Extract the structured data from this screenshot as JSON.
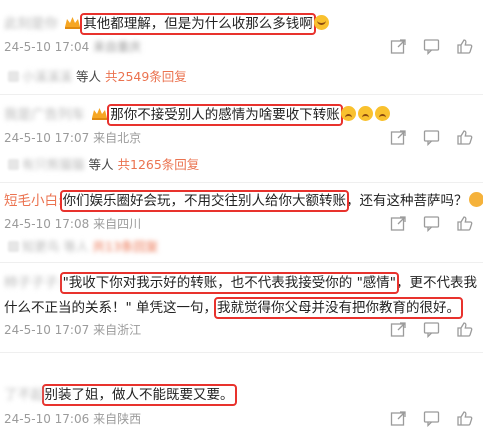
{
  "comments": [
    {
      "username": "此刻是你",
      "text": "其他都理解，但是为什么收那么多钱啊",
      "meta_date": "24-5-10 17:04",
      "meta_from": "来自重庆",
      "reply_user": "小溪溪溪",
      "reply_suffix": "等人",
      "reply_count": "共2549条回复"
    },
    {
      "username": "我是广告列车",
      "text": "那你不接受别人的感情为啥要收下转账",
      "meta_date": "24-5-10 17:07",
      "meta_from": "来自北京",
      "reply_user": "有只熊猫猫",
      "reply_suffix": "等人",
      "reply_count": "共1265条回复"
    },
    {
      "username": "短毛小白:",
      "text_hl": "你们娱乐圈好会玩，不用交往别人给你大额转账",
      "text_rest": "，还有这种菩萨吗？",
      "meta_date": "24-5-10 17:08",
      "meta_from": "来自四川",
      "reply_user": "知更鸟",
      "reply_suffix": "等人",
      "reply_count": "共13条回复"
    },
    {
      "username": "柿子子子:",
      "text_line1_hl": "\"我收下你对我示好的转账，也不代表我接受你的 \"感情\"",
      "text_line1_rest": "，更不代表我",
      "text_line2_pre": "什么不正当的关系！\" 单凭这一句，",
      "text_line2_hl": "我就觉得你父母并没有把你教育的很好。",
      "meta_date": "24-5-10 17:07",
      "meta_from": "来自浙江",
      "reply_user": "",
      "reply_suffix": "",
      "reply_count": ""
    },
    {
      "username": "了不起",
      "text": "别装了姐，做人不能既要又要。",
      "meta_date": "24-5-10 17:06",
      "meta_from": "来自陕西",
      "reply_user": "",
      "reply_suffix": "",
      "reply_count": ""
    }
  ]
}
